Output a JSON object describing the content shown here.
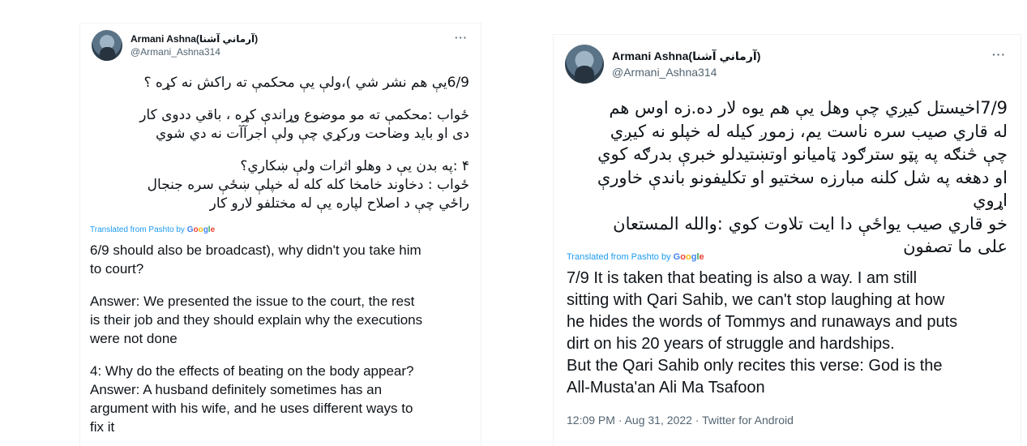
{
  "tweets": [
    {
      "display_name": "Armani Ashna(آرماني آشنا)",
      "handle": "@Armani_Ashna314",
      "more_label": "···",
      "original_lines": [
        "6/9يې هم نشر شي )،ولې يې محکمې ته راکش نه کړه ؟",
        "",
        "ځواب :محکمې ته مو موضوع وړاندې کړه ، باقي ددوی کار",
        "دی او باید وضاحت ورکړي چې ولې اجرآآت نه دي شوي",
        "",
        "۴ :په بدن يې د وهلو اثرات ولې ښکاري؟",
        "ځواب : دخاوند خامخا کله کله  له خپلې ښځې سره جنجال",
        "راځي چې د اصلاح لپاره يې له مختلفو لارو کار"
      ],
      "translated_label": "Translated from Pashto by",
      "translation_lines": [
        "6/9 should also be broadcast), why didn't you take him",
        "to court?",
        "",
        "Answer: We presented the issue to the court, the rest",
        "is their job and they should explain why the executions",
        "were not done",
        "",
        "4: Why do the effects of beating on the body appear?",
        "Answer: A husband definitely sometimes has an",
        "argument with his wife, and he uses different ways to",
        "fix it"
      ]
    },
    {
      "display_name": "Armani Ashna(آرماني آشنا)",
      "handle": "@Armani_Ashna314",
      "more_label": "···",
      "original_lines": [
        "7/9اخيستل کيږي چې وهل يې هم يوه لار ده.زه اوس هم",
        "له قاري صيب سره ناست يم، زموږ کيله له خپلو نه کيږي",
        "چې څنګه په پټو سترګود ټاميانو اوتښتيدلو خبرې بدرګه کوي",
        "او دهغه په شل کلنه مبارزه سختيو او تکليفونو باندې خاورې",
        "اړوي",
        "خو قاري صيب يواځې دا ايت تلاوت کوي :والله المستعان",
        "على ما تصفون"
      ],
      "translated_label": "Translated from Pashto by",
      "translation_lines": [
        "7/9 It is taken that beating is also a way. I am still",
        "sitting with Qari Sahib, we can't stop laughing at how",
        "he hides the words of Tommys and runaways and puts",
        "dirt on his 20 years of struggle and hardships.",
        "But the Qari Sahib only recites this verse: God is the",
        "All-Musta'an Ali Ma Tsafoon"
      ],
      "timestamp": "12:09 PM · Aug 31, 2022 · Twitter for Android"
    }
  ],
  "google_logo_letters": [
    "G",
    "o",
    "o",
    "g",
    "l",
    "e"
  ]
}
